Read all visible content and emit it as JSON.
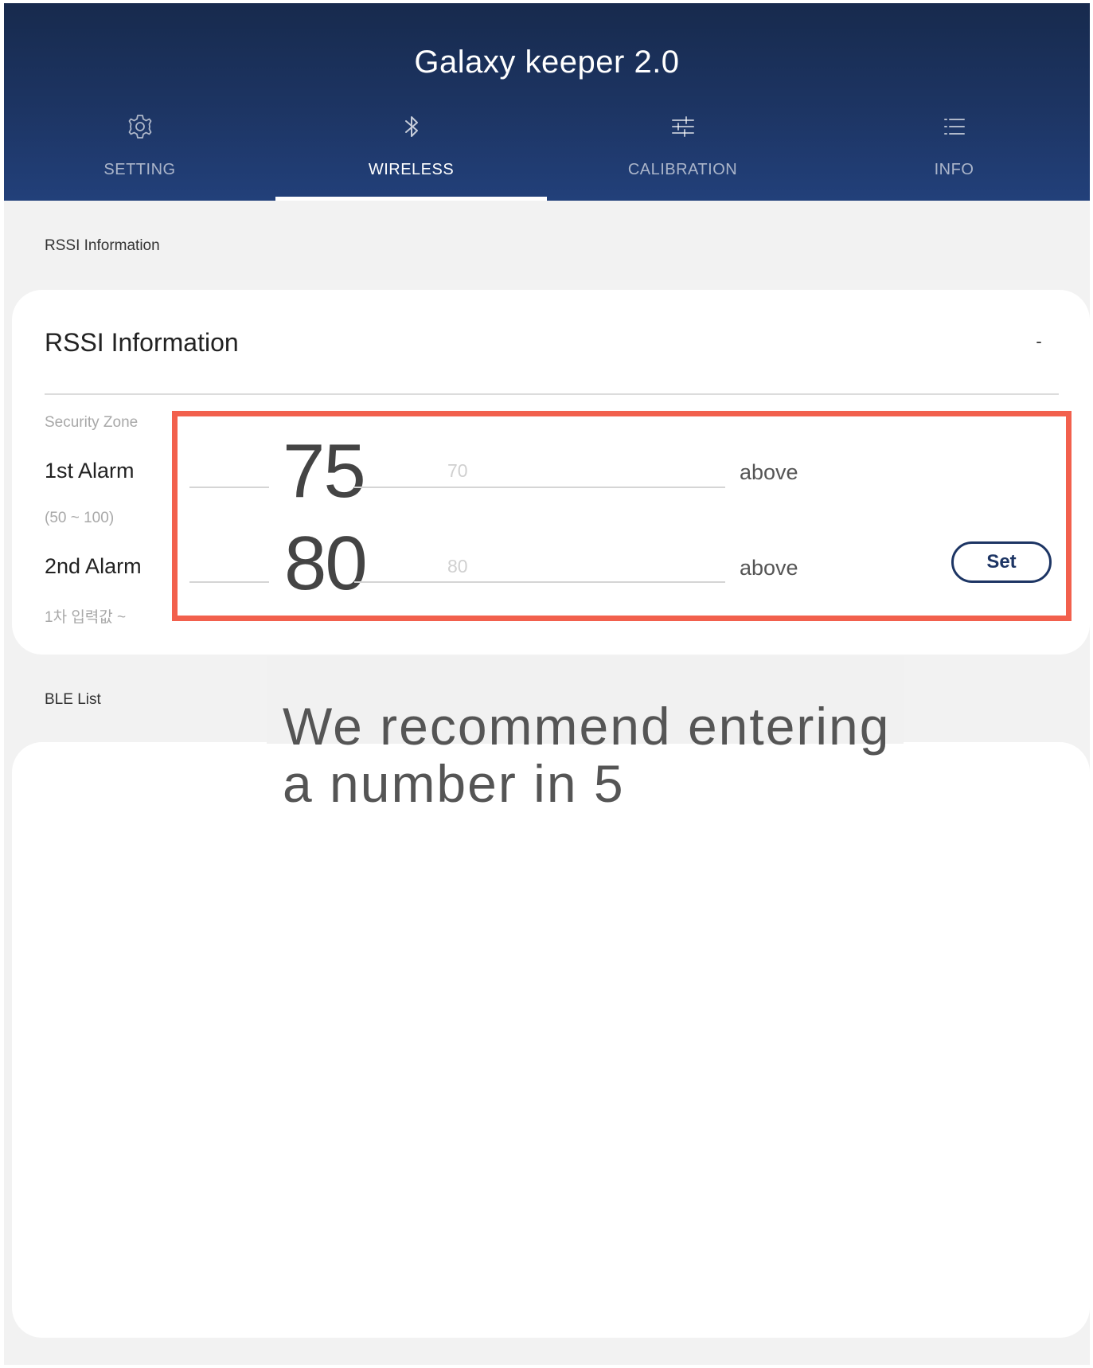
{
  "app": {
    "title": "Galaxy keeper 2.0"
  },
  "tabs": [
    {
      "label": "SETTING",
      "icon": "gear-icon",
      "active": false
    },
    {
      "label": "WIRELESS",
      "icon": "bluetooth-icon",
      "active": true
    },
    {
      "label": "CALIBRATION",
      "icon": "sliders-icon",
      "active": false
    },
    {
      "label": "INFO",
      "icon": "list-icon",
      "active": false
    }
  ],
  "rssi_section": {
    "label": "RSSI Information",
    "card_title": "RSSI Information",
    "collapse_symbol": "-",
    "zone_label": "Security Zone",
    "alarm1": {
      "label": "1st Alarm",
      "value": "75",
      "placeholder": "70",
      "unit": "above",
      "range_hint": "(50 ~ 100)"
    },
    "alarm2": {
      "label": "2nd Alarm",
      "value": "80",
      "placeholder": "80",
      "unit": "above",
      "range_hint": "1차 입력값 ~"
    },
    "set_label": "Set"
  },
  "ble_section": {
    "label": "BLE List"
  },
  "tooltip": {
    "line1": "We recommend entering",
    "line2": "a number in 5"
  },
  "colors": {
    "header_top": "#172a4d",
    "header_bottom": "#22407a",
    "accent": "#1d3564",
    "highlight": "#f2604d",
    "background": "#f2f2f2"
  }
}
